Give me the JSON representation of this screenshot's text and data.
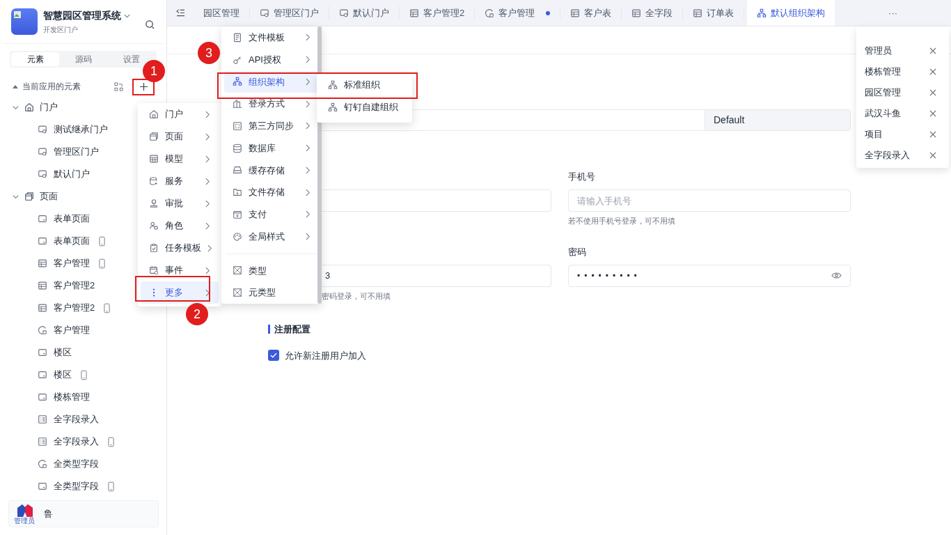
{
  "sidebar": {
    "app_title": "智慧园区管理系统",
    "app_subtitle": "开发区门户",
    "tabs": [
      {
        "label": "元素",
        "selected": true
      },
      {
        "label": "源码",
        "selected": false
      },
      {
        "label": "设置",
        "selected": false
      }
    ],
    "section_title": "当前应用的元素",
    "tree": [
      {
        "label": "门户",
        "kind": "portal",
        "expanded": true,
        "children": [
          {
            "label": "测试继承门户",
            "kind": "portal-page",
            "mobile": false
          },
          {
            "label": "管理区门户",
            "kind": "portal-page",
            "mobile": false
          },
          {
            "label": "默认门户",
            "kind": "portal-page",
            "mobile": false
          }
        ]
      },
      {
        "label": "页面",
        "kind": "page",
        "expanded": true,
        "children": [
          {
            "label": "表单页面",
            "kind": "form",
            "mobile": false
          },
          {
            "label": "表单页面",
            "kind": "form",
            "mobile": true
          },
          {
            "label": "客户管理",
            "kind": "table",
            "mobile": true
          },
          {
            "label": "客户管理2",
            "kind": "table",
            "mobile": false
          },
          {
            "label": "客户管理2",
            "kind": "table",
            "mobile": true
          },
          {
            "label": "客户管理",
            "kind": "chart",
            "mobile": false
          },
          {
            "label": "楼区",
            "kind": "form",
            "mobile": false
          },
          {
            "label": "楼区",
            "kind": "form",
            "mobile": true
          },
          {
            "label": "楼栋管理",
            "kind": "form",
            "mobile": false
          },
          {
            "label": "全字段录入",
            "kind": "list",
            "mobile": false
          },
          {
            "label": "全字段录入",
            "kind": "list",
            "mobile": true
          },
          {
            "label": "全类型字段",
            "kind": "chart",
            "mobile": false
          },
          {
            "label": "全类型字段",
            "kind": "form",
            "mobile": true
          }
        ]
      }
    ],
    "user": {
      "name": "鲁",
      "badge": "管理员"
    }
  },
  "tab_bar": {
    "tabs": [
      {
        "label": "园区管理",
        "kind": "none",
        "selected": false,
        "modified": false
      },
      {
        "label": "管理区门户",
        "kind": "portal-page",
        "selected": false,
        "modified": false
      },
      {
        "label": "默认门户",
        "kind": "portal-page",
        "selected": false,
        "modified": false
      },
      {
        "label": "客户管理2",
        "kind": "table",
        "selected": false,
        "modified": false
      },
      {
        "label": "客户管理",
        "kind": "chart",
        "selected": false,
        "modified": true
      },
      {
        "label": "客户表",
        "kind": "table",
        "selected": false,
        "modified": false
      },
      {
        "label": "全字段",
        "kind": "table",
        "selected": false,
        "modified": false
      },
      {
        "label": "订单表",
        "kind": "table",
        "selected": false,
        "modified": false
      },
      {
        "label": "默认组织架构",
        "kind": "org",
        "selected": true,
        "modified": false
      }
    ],
    "more": "···"
  },
  "tab_dropdown": {
    "items": [
      "管理员",
      "楼栋管理",
      "园区管理",
      "武汉斗鱼",
      "项目",
      "全字段录入"
    ]
  },
  "form": {
    "addon": "Default",
    "left_value": "3",
    "left_hint": "密码登录，可不用填",
    "phone_label": "手机号",
    "phone_placeholder": "请输入手机号",
    "phone_hint": "若不使用手机号登录，可不用填",
    "password_label": "密码",
    "password_mask": "•••••••••",
    "section_title": "注册配置",
    "checkbox": {
      "label": "允许新注册用户加入",
      "checked": true
    }
  },
  "menus": [
    {
      "items": [
        {
          "label": "门户",
          "kind": "portal",
          "selected": false,
          "submenu": true
        },
        {
          "label": "页面",
          "kind": "page",
          "selected": false,
          "submenu": true
        },
        {
          "label": "模型",
          "kind": "model",
          "selected": false,
          "submenu": true
        },
        {
          "label": "服务",
          "kind": "service",
          "selected": false,
          "submenu": true
        },
        {
          "label": "审批",
          "kind": "approval",
          "selected": false,
          "submenu": true
        },
        {
          "label": "角色",
          "kind": "role",
          "selected": false,
          "submenu": true
        },
        {
          "label": "任务模板",
          "kind": "task",
          "selected": false,
          "submenu": true
        },
        {
          "label": "事件",
          "kind": "event",
          "selected": false,
          "submenu": true
        },
        {
          "label": "更多",
          "kind": "more",
          "selected": true,
          "submenu": true
        }
      ]
    },
    {
      "items": [
        {
          "label": "文件模板",
          "kind": "file",
          "selected": false,
          "submenu": true
        },
        {
          "label": "API授权",
          "kind": "api",
          "selected": false,
          "submenu": true
        },
        {
          "label": "组织架构",
          "kind": "org",
          "selected": true,
          "submenu": true
        },
        {
          "label": "登录方式",
          "kind": "login",
          "selected": false,
          "submenu": true
        },
        {
          "label": "第三方同步",
          "kind": "sync",
          "selected": false,
          "submenu": true
        },
        {
          "label": "数据库",
          "kind": "database",
          "selected": false,
          "submenu": true
        },
        {
          "label": "缓存存储",
          "kind": "cache",
          "selected": false,
          "submenu": true
        },
        {
          "label": "文件存储",
          "kind": "storage",
          "selected": false,
          "submenu": true
        },
        {
          "label": "支付",
          "kind": "pay",
          "selected": false,
          "submenu": true
        },
        {
          "label": "全局样式",
          "kind": "style",
          "selected": false,
          "submenu": true
        },
        {
          "label": "类型",
          "kind": "type",
          "selected": false,
          "submenu": false,
          "divider_before": true
        },
        {
          "label": "元类型",
          "kind": "type",
          "selected": false,
          "submenu": false
        }
      ]
    },
    {
      "items": [
        {
          "label": "标准组织",
          "kind": "org",
          "selected": false,
          "submenu": false
        },
        {
          "label": "钉钉自建组织",
          "kind": "org",
          "selected": false,
          "submenu": false
        }
      ]
    }
  ],
  "annotations": [
    {
      "label": "1"
    },
    {
      "label": "2"
    },
    {
      "label": "3"
    }
  ]
}
